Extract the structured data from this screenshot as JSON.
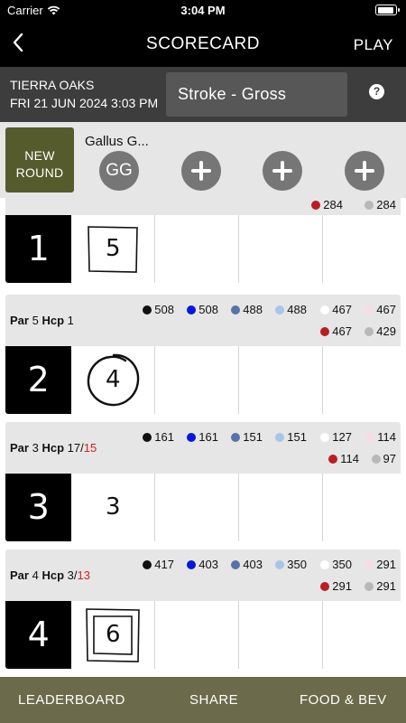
{
  "status": {
    "carrier": "Carrier",
    "time": "3:04 PM"
  },
  "header": {
    "title": "SCORECARD",
    "play_label": "PLAY"
  },
  "course": {
    "name": "TIERRA OAKS",
    "datetime": "FRI 21 JUN 2024 3:03 PM",
    "format": "Stroke - Gross",
    "help": "?"
  },
  "players": {
    "new_round_line1": "NEW",
    "new_round_line2": "ROUND",
    "player_name": "Gallus G...",
    "player_initials": "GG"
  },
  "tee_colors": {
    "black": "#111111",
    "blue": "#0a16d8",
    "slate": "#5a72a8",
    "lightblue": "#a8c4e8",
    "white": "#ffffff",
    "pink": "#f6dce6",
    "red": "#b81e24",
    "gray": "#b8b8b8"
  },
  "partial_hole": {
    "tee_red": "284",
    "tee_gray": "284"
  },
  "holes": [
    {
      "number": "1",
      "score": "5"
    },
    {
      "number": "2",
      "par": "5",
      "hcp": "1",
      "hcp_alt": "",
      "score": "4",
      "tees": {
        "black": "508",
        "blue": "508",
        "slate": "488",
        "lightblue": "488",
        "white": "467",
        "pink": "467",
        "red": "467",
        "gray": "429"
      }
    },
    {
      "number": "3",
      "par": "3",
      "hcp": "17/",
      "hcp_alt": "15",
      "score": "3",
      "tees": {
        "black": "161",
        "blue": "161",
        "slate": "151",
        "lightblue": "151",
        "white": "127",
        "pink": "114",
        "red": "114",
        "gray": "97"
      }
    },
    {
      "number": "4",
      "par": "4",
      "hcp": "3/",
      "hcp_alt": "13",
      "score": "6",
      "tees": {
        "black": "417",
        "blue": "403",
        "slate": "403",
        "lightblue": "350",
        "white": "350",
        "pink": "291",
        "red": "291",
        "gray": "291"
      }
    }
  ],
  "labels": {
    "par": "Par",
    "hcp": "Hcp"
  },
  "bottom": {
    "leaderboard": "LEADERBOARD",
    "share": "SHARE",
    "food_bev": "FOOD & BEV"
  }
}
